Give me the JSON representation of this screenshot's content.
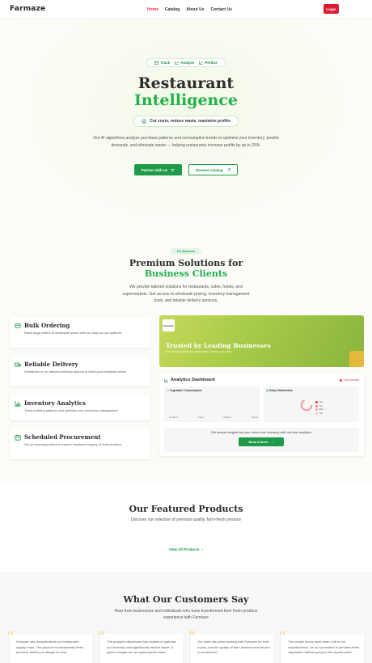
{
  "nav": {
    "logo": "Farmaze",
    "links": [
      "Home",
      "Catalog",
      "About Us",
      "Contact Us"
    ],
    "login": "Login"
  },
  "hero": {
    "pills": [
      "Track",
      "Analyze",
      "Predict"
    ],
    "title_line1": "Restaurant",
    "title_line2": "Intelligence",
    "tagline": "Cut costs, reduce waste, maximize profits",
    "description": "Our AI algorithms analyze purchase patterns and consumption trends to optimize your inventory, predict demands, and eliminate waste — helping restaurants increase profits by up to 25%.",
    "partner_button": "Partner with us",
    "catalog_button": "Browse catalog"
  },
  "business": {
    "badge": "For Business",
    "title_line1": "Premium Solutions for",
    "title_line2": "Business Clients",
    "description": "We provide tailored solutions for restaurants, cafes, hotels, and supermarkets. Get access to wholesale pricing, inventory management tools, and reliable delivery services.",
    "features": [
      {
        "title": "Bulk Ordering",
        "desc": "Place large orders at wholesale prices with our easy-to-use platform."
      },
      {
        "title": "Reliable Delivery",
        "desc": "Scheduled or on-demand delivery options to meet your business needs"
      },
      {
        "title": "Inventory Analytics",
        "desc": "Track ordering patterns and optimize your inventory management"
      },
      {
        "title": "Scheduled Procurement",
        "desc": "Set up recurring orders to ensure consistent supply of fresh produce"
      }
    ],
    "trusted": {
      "logo": "Farmaze",
      "title": "Trusted by Leading Businesses",
      "subtitle": "Our clients include top restaurants, hotels, and cafes"
    },
    "dashboard": {
      "title": "Analytics Dashboard",
      "live": "Live preview",
      "panel1_title": "Vegetable Consumption",
      "panel1_labels": [
        "Tomatoes",
        "Onions",
        "Potatoes",
        "Carrots"
      ],
      "panel2_title": "Daily Distribution",
      "legend": [
        "Mon",
        "Tue",
        "Wed",
        "Thu"
      ],
      "insight": "Get deeper insights into your orders and inventory with real-time analytics.",
      "demo_button": "Book a Demo"
    }
  },
  "products": {
    "title": "Our Featured Products",
    "subtitle": "Discover our selection of premium quality, farm-fresh produce",
    "view_all": "View All Products"
  },
  "testimonials": {
    "title": "What Our Customers Say",
    "subtitle": "Hear from businesses and individuals who have transformed their fresh produce experience with Farmaze",
    "cards": [
      "Farmaze has revolutionized our restaurant's supply chain. The produce is consistently fresh, and their delivery is always on time.",
      "The analytics dashboard has helped us optimize our inventory and significantly reduce waste. A game-changer for our supermarket chain.",
      "Our hotel has been working with Farmaze for over a year, and the quality of their produce and service is unmatched.",
      "The mobile trucks have been a hit in our neighborhood. It's so convenient to get farm-fresh vegetables without going to the supermarket."
    ]
  },
  "colors": {
    "brand_green": "#1f9a48",
    "accent_green": "#22b04b",
    "accent_red": "#d91c34",
    "quote_yellow": "#f6d98b"
  }
}
